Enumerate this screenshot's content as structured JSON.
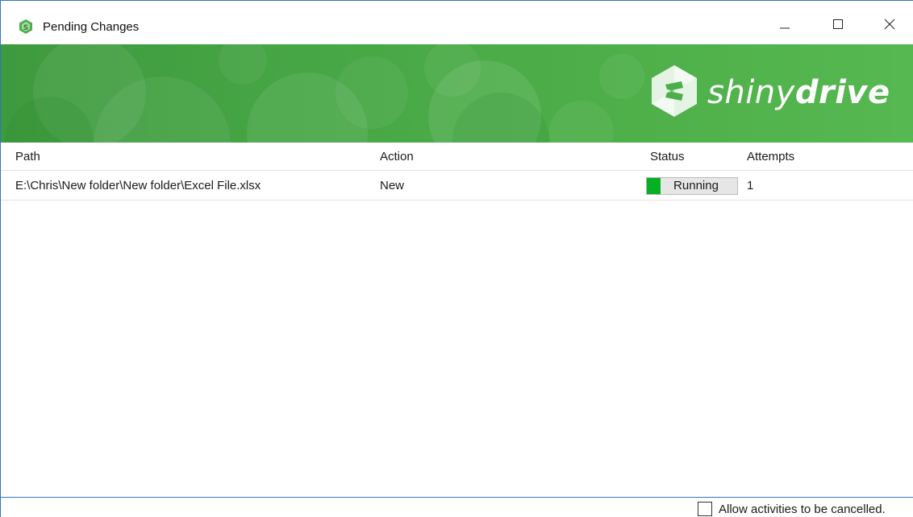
{
  "window": {
    "title": "Pending Changes",
    "icon": "shinydrive-app-icon",
    "controls": {
      "minimize": "minimize-icon",
      "maximize": "maximize-icon",
      "close": "close-icon"
    }
  },
  "banner": {
    "brand_light": "shiny",
    "brand_bold": "drive",
    "logo_icon": "shinydrive-logo-icon",
    "colors": {
      "green": "#4caf4a",
      "white": "#ffffff"
    }
  },
  "table": {
    "columns": [
      "Path",
      "Action",
      "Status",
      "Attempts"
    ],
    "rows": [
      {
        "path": "E:\\Chris\\New folder\\New folder\\Excel File.xlsx",
        "action": "New",
        "status": "Running",
        "status_progress": 0.15,
        "attempts": "1"
      }
    ],
    "status_color": "#06b025"
  },
  "footer": {
    "checkbox_label": "Allow activities to be cancelled.",
    "checkbox_checked": false
  }
}
